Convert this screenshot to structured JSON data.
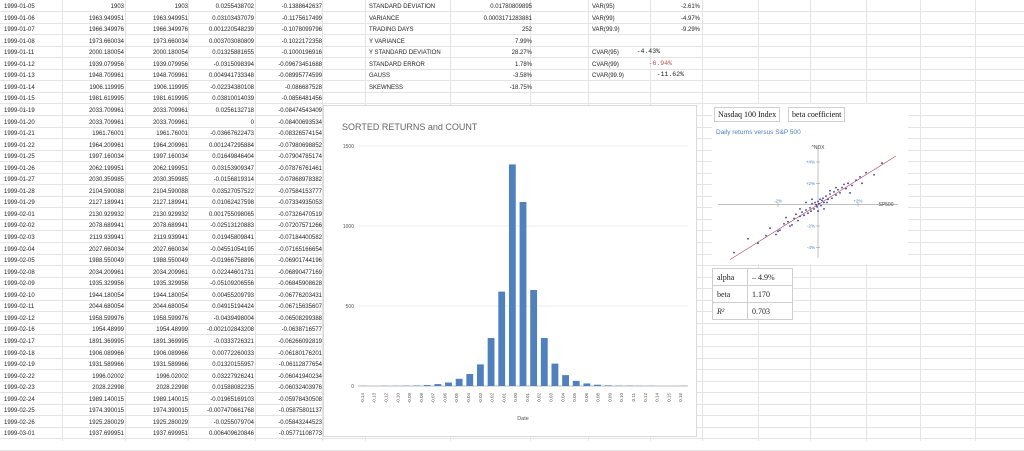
{
  "sheet": {
    "rows": [
      [
        "1999-01-05",
        "1903",
        "1903",
        "0.0255438702",
        "-0.1388642637"
      ],
      [
        "1999-01-06",
        "1963.949951",
        "1963.949951",
        "0.03103437079",
        "-0.1175617499"
      ],
      [
        "1999-01-07",
        "1966.349976",
        "1966.349976",
        "0.001220548239",
        "-0.1078099796"
      ],
      [
        "1999-01-08",
        "1973.660034",
        "1973.660034",
        "0.003703080809",
        "-0.1022172358"
      ],
      [
        "1999-01-11",
        "2000.180054",
        "2000.180054",
        "0.01325881655",
        "-0.1000196916"
      ],
      [
        "1999-01-12",
        "1939.079956",
        "1939.079956",
        "-0.0315098394",
        "-0.09673451688"
      ],
      [
        "1999-01-13",
        "1948.709961",
        "1948.709961",
        "0.004941733348",
        "-0.08995774599"
      ],
      [
        "1999-01-14",
        "1906.119995",
        "1906.119995",
        "-0.02234380108",
        "-0.086687528"
      ],
      [
        "1999-01-15",
        "1981.619995",
        "1981.619995",
        "0.03810014039",
        "-0.0856481456"
      ],
      [
        "1999-01-19",
        "2033.709961",
        "2033.709961",
        "0.0256132718",
        "-0.08474543409"
      ],
      [
        "1999-01-20",
        "2033.709961",
        "2033.709961",
        "0",
        "-0.08400693534"
      ],
      [
        "1999-01-21",
        "1961.76001",
        "1961.76001",
        "-0.03667622473",
        "-0.08326574154"
      ],
      [
        "1999-01-22",
        "1964.209961",
        "1964.209961",
        "0.001247295884",
        "-0.07980698852"
      ],
      [
        "1999-01-25",
        "1997.160034",
        "1997.160034",
        "0.01649846404",
        "-0.07904785174"
      ],
      [
        "1999-01-26",
        "2062.199951",
        "2062.199951",
        "0.03153909347",
        "-0.07876761461"
      ],
      [
        "1999-01-27",
        "2030.359985",
        "2030.359985",
        "-0.0156819314",
        "-0.07868978382"
      ],
      [
        "1999-01-28",
        "2104.590088",
        "2104.590088",
        "0.03527057522",
        "-0.07584153777"
      ],
      [
        "1999-01-29",
        "2127.189941",
        "2127.189941",
        "0.01062427598",
        "-0.07334935053"
      ],
      [
        "1999-02-01",
        "2130.929932",
        "2130.929932",
        "0.001755098065",
        "-0.07326470519"
      ],
      [
        "1999-02-02",
        "2078.689941",
        "2078.689941",
        "-0.02513120883",
        "-0.07207571266"
      ],
      [
        "1999-02-03",
        "2119.939941",
        "2119.939941",
        "0.01945809841",
        "-0.07184400582"
      ],
      [
        "1999-02-04",
        "2027.660034",
        "2027.660034",
        "-0.04551054195",
        "-0.07165166654"
      ],
      [
        "1999-02-05",
        "1988.550049",
        "1988.550049",
        "-0.01966758896",
        "-0.06901744196"
      ],
      [
        "1999-02-08",
        "2034.209961",
        "2034.209961",
        "0.02244601731",
        "-0.06890477169"
      ],
      [
        "1999-02-09",
        "1935.329956",
        "1935.329956",
        "-0.05109206556",
        "-0.06845908628"
      ],
      [
        "1999-02-10",
        "1944.180054",
        "1944.180054",
        "0.00455209793",
        "-0.06776203431"
      ],
      [
        "1999-02-11",
        "2044.680054",
        "2044.680054",
        "0.04915194424",
        "-0.06715635607"
      ],
      [
        "1999-02-12",
        "1958.599976",
        "1958.599976",
        "-0.0439498004",
        "-0.06508299388"
      ],
      [
        "1999-02-16",
        "1954.48999",
        "1954.48999",
        "-0.002102843208",
        "-0.0638716577"
      ],
      [
        "1999-02-17",
        "1891.369995",
        "1891.369995",
        "-0.0333726321",
        "-0.06266092819"
      ],
      [
        "1999-02-18",
        "1906.089966",
        "1906.089966",
        "0.00772260033",
        "-0.06180176201"
      ],
      [
        "1999-02-19",
        "1931.589966",
        "1931.589966",
        "0.01320155957",
        "-0.06112877654"
      ],
      [
        "1999-02-22",
        "1996.02002",
        "1996.02002",
        "0.03227926241",
        "-0.06041940234"
      ],
      [
        "1999-02-23",
        "2028.22998",
        "2028.22998",
        "0.01588082235",
        "-0.06032403976"
      ],
      [
        "1999-02-24",
        "1989.140015",
        "1989.140015",
        "-0.01965169103",
        "-0.05978430508"
      ],
      [
        "1999-02-25",
        "1974.390015",
        "1974.390015",
        "-0.007470661768",
        "-0.05875801137"
      ],
      [
        "1999-02-26",
        "1925.280029",
        "1925.280029",
        "-0.0255079704",
        "-0.05843244523"
      ],
      [
        "1999-03-01",
        "1937.699951",
        "1937.699951",
        "0.006409620846",
        "-0.05771108773"
      ]
    ],
    "stats_labels": [
      "STANDARD DEVIATION",
      "VARIANCE",
      "TRADING DAYS",
      "Y VARIANCE",
      "Y STANDARD DEVIATION",
      "STANDARD ERROR",
      "GAUSS",
      "SKEWNESS"
    ],
    "stats_values": [
      "0.01780809895",
      "0.0003171283881",
      "252",
      "7.99%",
      "28.27%",
      "1.78%",
      "-3.58%",
      "-18.75%"
    ],
    "var_labels": [
      "VAR(95)",
      "VAR(99)",
      "VAR(99.9)"
    ],
    "var_values": [
      "-2.61%",
      "-4.97%",
      "-9.29%"
    ],
    "cvar_labels": [
      "CVAR(95)",
      "CVAR(99)",
      "CVAR(99.9)"
    ],
    "cvar_values": [
      "-4.43%",
      "-6.94%",
      "-11.62%"
    ]
  },
  "colors": {
    "bar": "#4f81bd",
    "cvar99": "#c0504d",
    "scatter_point": "#3b3ba0",
    "trendline": "#b04a5a",
    "subtitle": "#4f81bd"
  },
  "histogram": {
    "title": "SORTED RETURNS and COUNT",
    "xlabel": "Date",
    "y_ticks": [
      "0",
      "500",
      "1000",
      "1500"
    ],
    "x_ticks": [
      "-0.14",
      "-0.13",
      "-0.12",
      "-0.10",
      "-0.09",
      "-0.08",
      "-0.07",
      "-0.06",
      "-0.05",
      "-0.04",
      "-0.03",
      "-0.02",
      "-0.01",
      "0.00",
      "0.01",
      "0.02",
      "0.03",
      "0.04",
      "0.05",
      "0.06",
      "0.08",
      "0.09",
      "0.10",
      "0.11",
      "0.12",
      "0.14",
      "0.15",
      "0.16"
    ]
  },
  "chart_data": {
    "type": "bar",
    "title": "SORTED RETURNS and COUNT",
    "xlabel": "Date",
    "ylabel": "",
    "ylim": [
      0,
      1500
    ],
    "categories": [
      "-0.14",
      "-0.13",
      "-0.12",
      "-0.11",
      "-0.10",
      "-0.09",
      "-0.08",
      "-0.07",
      "-0.06",
      "-0.05",
      "-0.04",
      "-0.03",
      "-0.02",
      "-0.01",
      "0.00",
      "0.01",
      "0.02",
      "0.03",
      "0.04",
      "0.05",
      "0.06",
      "0.07",
      "0.08",
      "0.09",
      "0.10",
      "0.11",
      "0.12",
      "0.13",
      "0.14",
      "0.15",
      "0.16"
    ],
    "values": [
      1,
      0,
      1,
      1,
      2,
      3,
      6,
      12,
      22,
      45,
      75,
      135,
      300,
      590,
      1385,
      1150,
      600,
      300,
      140,
      68,
      32,
      16,
      8,
      4,
      2,
      2,
      1,
      1,
      0,
      0,
      1
    ],
    "grid": true
  },
  "beta_panel": {
    "tab_left": "Nasdaq 100 Index",
    "tab_right": "beta coefficient",
    "subtitle": "Daily returns versus S&P 500",
    "y_axis_label": "^NDX",
    "x_axis_label": "SP500",
    "y_ticks": [
      "+4%",
      "+2%",
      "-2%",
      "-4%"
    ],
    "x_ticks": [
      "-2%",
      "+2%"
    ],
    "stats_rows": [
      {
        "label": "alpha",
        "value": "– 4.9%"
      },
      {
        "label": "beta",
        "value": "1.170"
      },
      {
        "label": "R²",
        "value": "0.703"
      }
    ]
  },
  "scatter_data": {
    "type": "scatter",
    "x_unit": "%",
    "y_unit": "%",
    "xlim": [
      -5,
      4
    ],
    "ylim": [
      -5,
      5.5
    ],
    "x": [
      -4.2,
      -3.5,
      -3.0,
      -2.6,
      -2.4,
      -2.1,
      -1.9,
      -1.7,
      -1.5,
      -1.4,
      -1.2,
      -1.1,
      -1.0,
      -0.9,
      -0.8,
      -0.7,
      -0.6,
      -0.5,
      -0.4,
      -0.35,
      -0.3,
      -0.2,
      -0.15,
      -0.1,
      -0.05,
      0.0,
      0.05,
      0.1,
      0.15,
      0.2,
      0.25,
      0.3,
      0.4,
      0.5,
      0.6,
      0.7,
      0.8,
      0.9,
      1.0,
      1.1,
      1.2,
      1.4,
      1.5,
      1.7,
      1.9,
      2.1,
      2.4,
      2.8,
      3.2,
      -1.3,
      -0.6,
      0.3,
      0.9,
      1.6,
      -0.9,
      0.6,
      -2.0,
      2.2,
      0.0,
      -0.3,
      0.45,
      1.3,
      -1.6
    ],
    "y": [
      -4.5,
      -3.2,
      -3.6,
      -2.9,
      -2.2,
      -2.8,
      -2.4,
      -1.8,
      -1.6,
      -2.0,
      -1.3,
      -0.9,
      -1.5,
      -1.1,
      -0.7,
      -1.0,
      -0.5,
      -0.8,
      -0.3,
      -0.6,
      0.1,
      -0.4,
      0.2,
      0.0,
      -0.2,
      0.3,
      0.1,
      0.5,
      -0.1,
      0.4,
      0.6,
      0.2,
      0.8,
      0.5,
      1.0,
      0.6,
      1.2,
      0.9,
      1.4,
      1.1,
      1.6,
      1.5,
      2.0,
      1.8,
      2.3,
      2.6,
      3.0,
      2.8,
      3.9,
      -1.9,
      0.2,
      -0.4,
      1.6,
      1.1,
      -0.4,
      1.3,
      -2.5,
      2.0,
      -0.6,
      0.5,
      0.2,
      1.9,
      -1.2
    ],
    "trend": {
      "slope": 1.17,
      "intercept": 0.0
    }
  }
}
